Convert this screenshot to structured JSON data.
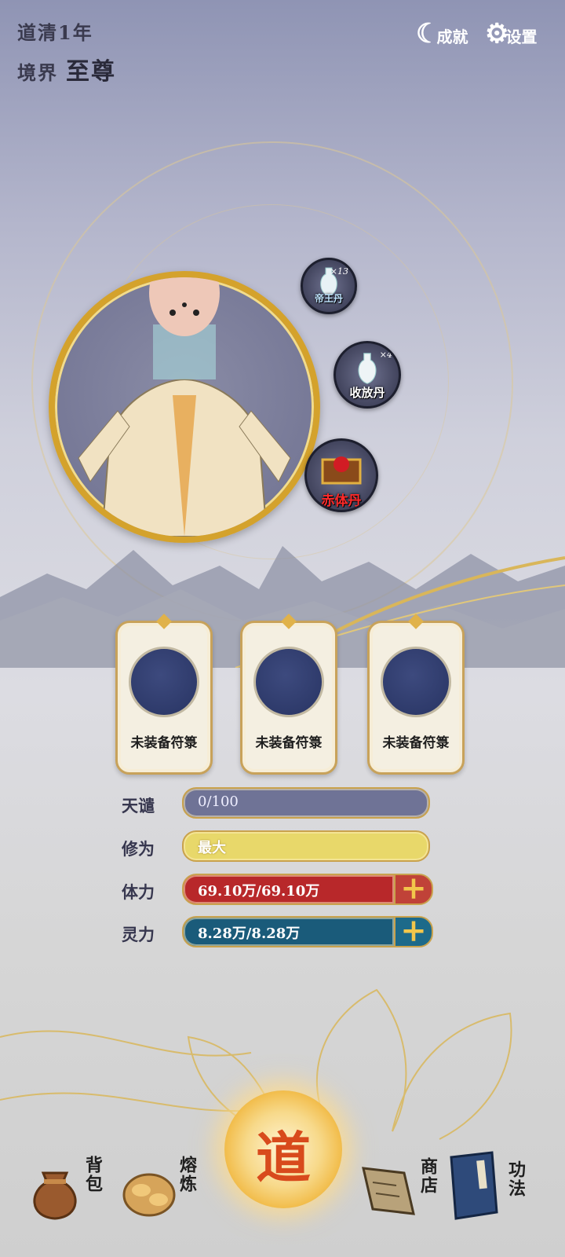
{
  "header": {
    "year_text": "道清1年",
    "realm_label": "境界",
    "realm_value": "至尊"
  },
  "top_buttons": {
    "achievement_label": "成就",
    "settings_label": "设置"
  },
  "pills": [
    {
      "name": "帝王丹",
      "count": "×13"
    },
    {
      "name": "收放丹",
      "count": "×4"
    },
    {
      "name": "赤体丹",
      "count": ""
    }
  ],
  "talismans": [
    {
      "label": "未装备符箓"
    },
    {
      "label": "未装备符箓"
    },
    {
      "label": "未装备符箓"
    }
  ],
  "stats": [
    {
      "label": "天谴",
      "value": "0/100",
      "fill": 0.0,
      "color": "#6f7396"
    },
    {
      "label": "修为",
      "value": "最大",
      "fill": 1.0,
      "color": "#e8d86a"
    },
    {
      "label": "体力",
      "value": "69.10万/69.10万",
      "fill": 1.0,
      "color": "#b8282a"
    },
    {
      "label": "灵力",
      "value": "8.28万/8.28万",
      "fill": 1.0,
      "color": "#1a5b7a"
    }
  ],
  "nav": {
    "bag": "背包",
    "smelt": "熔炼",
    "center": "道",
    "shop": "商店",
    "skills": "功法"
  },
  "colors": {
    "gold": "#d4a22c",
    "hp": "#b8282a",
    "mp": "#1a5b7a",
    "plus": "#f2c64b"
  }
}
